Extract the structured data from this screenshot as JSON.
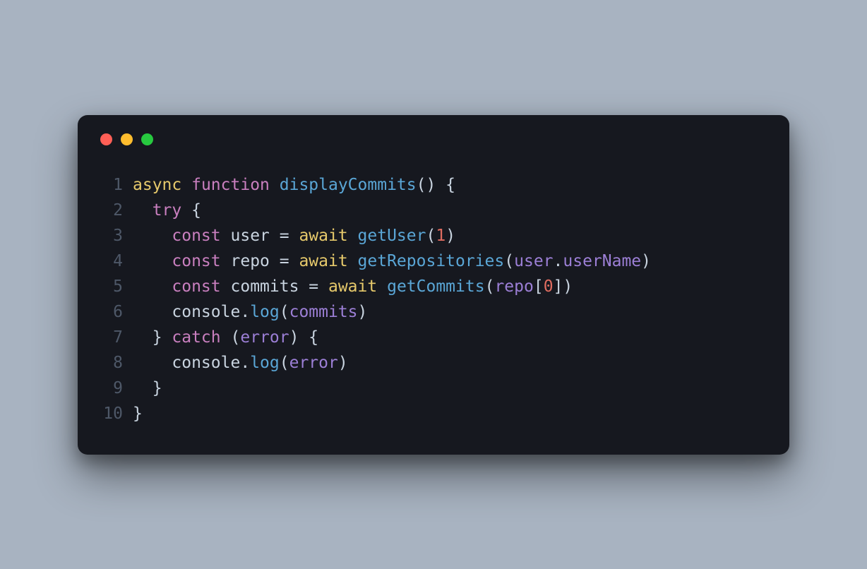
{
  "window": {
    "trafficLights": [
      "close",
      "minimize",
      "maximize"
    ]
  },
  "code": {
    "lines": [
      {
        "num": "1",
        "tokens": [
          {
            "t": "async",
            "c": "tok-kw1"
          },
          {
            "t": " ",
            "c": "tok-punc"
          },
          {
            "t": "function",
            "c": "tok-kw2"
          },
          {
            "t": " ",
            "c": "tok-punc"
          },
          {
            "t": "displayCommits",
            "c": "tok-func"
          },
          {
            "t": "()",
            "c": "tok-paren"
          },
          {
            "t": " {",
            "c": "tok-punc"
          }
        ]
      },
      {
        "num": "2",
        "tokens": [
          {
            "t": "  ",
            "c": "tok-punc"
          },
          {
            "t": "try",
            "c": "tok-kw2"
          },
          {
            "t": " {",
            "c": "tok-punc"
          }
        ]
      },
      {
        "num": "3",
        "tokens": [
          {
            "t": "    ",
            "c": "tok-punc"
          },
          {
            "t": "const",
            "c": "tok-kw2"
          },
          {
            "t": " ",
            "c": "tok-punc"
          },
          {
            "t": "user",
            "c": "tok-ident"
          },
          {
            "t": " = ",
            "c": "tok-punc"
          },
          {
            "t": "await",
            "c": "tok-kw1"
          },
          {
            "t": " ",
            "c": "tok-punc"
          },
          {
            "t": "getUser",
            "c": "tok-func"
          },
          {
            "t": "(",
            "c": "tok-paren"
          },
          {
            "t": "1",
            "c": "tok-num"
          },
          {
            "t": ")",
            "c": "tok-paren"
          }
        ]
      },
      {
        "num": "4",
        "tokens": [
          {
            "t": "    ",
            "c": "tok-punc"
          },
          {
            "t": "const",
            "c": "tok-kw2"
          },
          {
            "t": " ",
            "c": "tok-punc"
          },
          {
            "t": "repo",
            "c": "tok-ident"
          },
          {
            "t": " = ",
            "c": "tok-punc"
          },
          {
            "t": "await",
            "c": "tok-kw1"
          },
          {
            "t": " ",
            "c": "tok-punc"
          },
          {
            "t": "getRepositories",
            "c": "tok-func"
          },
          {
            "t": "(",
            "c": "tok-paren"
          },
          {
            "t": "user",
            "c": "tok-param"
          },
          {
            "t": ".",
            "c": "tok-dot"
          },
          {
            "t": "userName",
            "c": "tok-param"
          },
          {
            "t": ")",
            "c": "tok-paren"
          }
        ]
      },
      {
        "num": "5",
        "tokens": [
          {
            "t": "    ",
            "c": "tok-punc"
          },
          {
            "t": "const",
            "c": "tok-kw2"
          },
          {
            "t": " ",
            "c": "tok-punc"
          },
          {
            "t": "commits",
            "c": "tok-ident"
          },
          {
            "t": " = ",
            "c": "tok-punc"
          },
          {
            "t": "await",
            "c": "tok-kw1"
          },
          {
            "t": " ",
            "c": "tok-punc"
          },
          {
            "t": "getCommits",
            "c": "tok-func"
          },
          {
            "t": "(",
            "c": "tok-paren"
          },
          {
            "t": "repo",
            "c": "tok-param"
          },
          {
            "t": "[",
            "c": "tok-punc"
          },
          {
            "t": "0",
            "c": "tok-num"
          },
          {
            "t": "]",
            "c": "tok-punc"
          },
          {
            "t": ")",
            "c": "tok-paren"
          }
        ]
      },
      {
        "num": "6",
        "tokens": [
          {
            "t": "    ",
            "c": "tok-punc"
          },
          {
            "t": "console",
            "c": "tok-ident"
          },
          {
            "t": ".",
            "c": "tok-dot"
          },
          {
            "t": "log",
            "c": "tok-func"
          },
          {
            "t": "(",
            "c": "tok-paren"
          },
          {
            "t": "commits",
            "c": "tok-param"
          },
          {
            "t": ")",
            "c": "tok-paren"
          }
        ]
      },
      {
        "num": "7",
        "tokens": [
          {
            "t": "  } ",
            "c": "tok-punc"
          },
          {
            "t": "catch",
            "c": "tok-kw2"
          },
          {
            "t": " (",
            "c": "tok-paren"
          },
          {
            "t": "error",
            "c": "tok-param"
          },
          {
            "t": ") {",
            "c": "tok-paren"
          }
        ]
      },
      {
        "num": "8",
        "tokens": [
          {
            "t": "    ",
            "c": "tok-punc"
          },
          {
            "t": "console",
            "c": "tok-ident"
          },
          {
            "t": ".",
            "c": "tok-dot"
          },
          {
            "t": "log",
            "c": "tok-func"
          },
          {
            "t": "(",
            "c": "tok-paren"
          },
          {
            "t": "error",
            "c": "tok-param"
          },
          {
            "t": ")",
            "c": "tok-paren"
          }
        ]
      },
      {
        "num": "9",
        "tokens": [
          {
            "t": "  }",
            "c": "tok-punc"
          }
        ]
      },
      {
        "num": "10",
        "tokens": [
          {
            "t": "}",
            "c": "tok-punc"
          }
        ]
      }
    ]
  }
}
